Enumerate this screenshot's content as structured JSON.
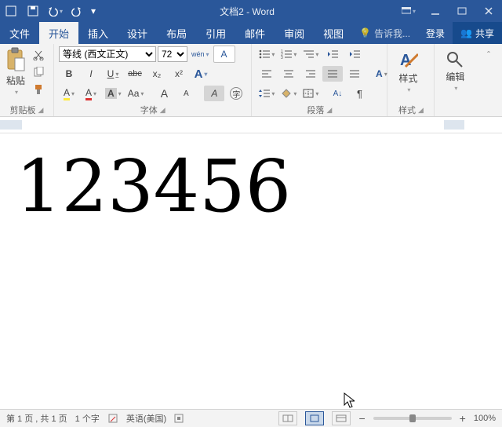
{
  "window": {
    "title": "文档2 - Word"
  },
  "tabs": {
    "file": "文件",
    "home": "开始",
    "insert": "插入",
    "design": "设计",
    "layout": "布局",
    "references": "引用",
    "mailings": "邮件",
    "review": "审阅",
    "view": "视图",
    "tellme": "告诉我...",
    "login": "登录",
    "share": "共享"
  },
  "font": {
    "name_value": "等线 (西文正文)",
    "size_value": "72"
  },
  "groups": {
    "clipboard": "剪贴板",
    "paste": "粘贴",
    "font": "字体",
    "paragraph": "段落",
    "styles": "样式",
    "stylebtn": "样式",
    "editing": "编辑"
  },
  "symbols": {
    "bold": "B",
    "italic": "I",
    "underline": "U",
    "strike": "abc",
    "sub": "x₂",
    "sup": "x²",
    "clear": "A",
    "phonetic": "wén",
    "charborder": "A",
    "caseAa": "Aa",
    "bigA": "A",
    "smallA": "A",
    "highlightA": "A",
    "fontcolorA": "A",
    "styleA": "A"
  },
  "doc": {
    "text": "123456"
  },
  "status": {
    "page": "第 1 页 , 共 1 页",
    "words": "1 个字",
    "lang": "英语(美国)",
    "zoom": "100%"
  }
}
